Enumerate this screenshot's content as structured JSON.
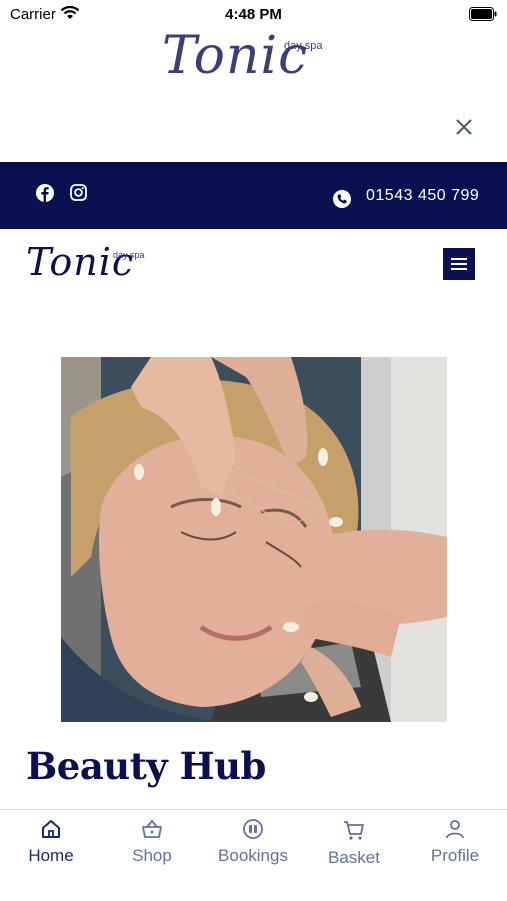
{
  "status_bar": {
    "carrier": "Carrier",
    "time": "4:48 PM"
  },
  "brand": {
    "logo_text": "Tonic",
    "logo_sub": "day spa"
  },
  "topbar": {
    "phone": "01543 450 799"
  },
  "main": {
    "title": "Beauty Hub"
  },
  "tabs": [
    {
      "label": "Home",
      "icon": "home-icon",
      "active": true
    },
    {
      "label": "Shop",
      "icon": "basket-icon"
    },
    {
      "label": "Bookings",
      "icon": "bookings-icon"
    },
    {
      "label": "Basket",
      "icon": "cart-icon"
    },
    {
      "label": "Profile",
      "icon": "profile-icon"
    }
  ],
  "colors": {
    "navy": "#0b1150",
    "tab_inactive": "#63719b",
    "logo": "#3a3f7a"
  }
}
